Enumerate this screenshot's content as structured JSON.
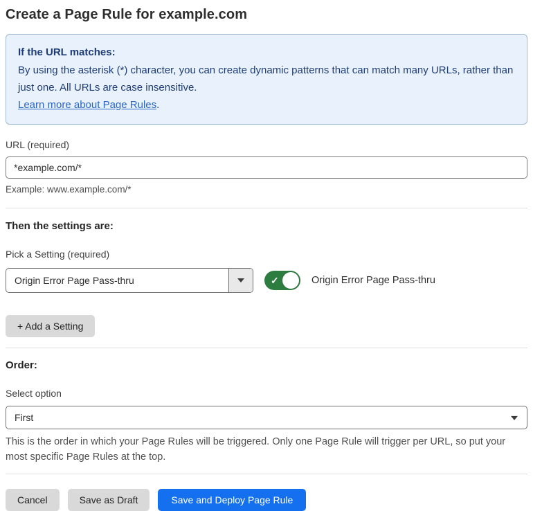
{
  "page": {
    "title": "Create a Page Rule for example.com"
  },
  "info_box": {
    "heading": "If the URL matches:",
    "body": "By using the asterisk (*) character, you can create dynamic patterns that can match many URLs, rather than just one. All URLs are case insensitive.",
    "link_label": "Learn more about Page Rules",
    "link_suffix": "."
  },
  "url_field": {
    "label": "URL (required)",
    "value": "*example.com/*",
    "helper": "Example: www.example.com/*"
  },
  "settings_section": {
    "heading": "Then the settings are:",
    "picker_label": "Pick a Setting (required)",
    "picker_value": "Origin Error Page Pass-thru",
    "toggle_label": "Origin Error Page Pass-thru",
    "toggle_state": "on",
    "toggle_check": "✓",
    "add_setting_label": "+ Add a Setting"
  },
  "order_section": {
    "heading": "Order:",
    "select_label": "Select option",
    "select_value": "First",
    "helper": "This is the order in which your Page Rules will be triggered. Only one Page Rule will trigger per URL, so put your most specific Page Rules at the top."
  },
  "actions": {
    "cancel_label": "Cancel",
    "save_draft_label": "Save as Draft",
    "save_deploy_label": "Save and Deploy Page Rule"
  },
  "colors": {
    "info_background": "#e9f2fc",
    "info_border": "#9fb9d1",
    "info_text": "#1e3c78",
    "link": "#2964c8",
    "toggle_on_green": "#2d7c40",
    "primary_button_blue": "#1570f0",
    "secondary_button_gray": "#d9d9d9"
  }
}
